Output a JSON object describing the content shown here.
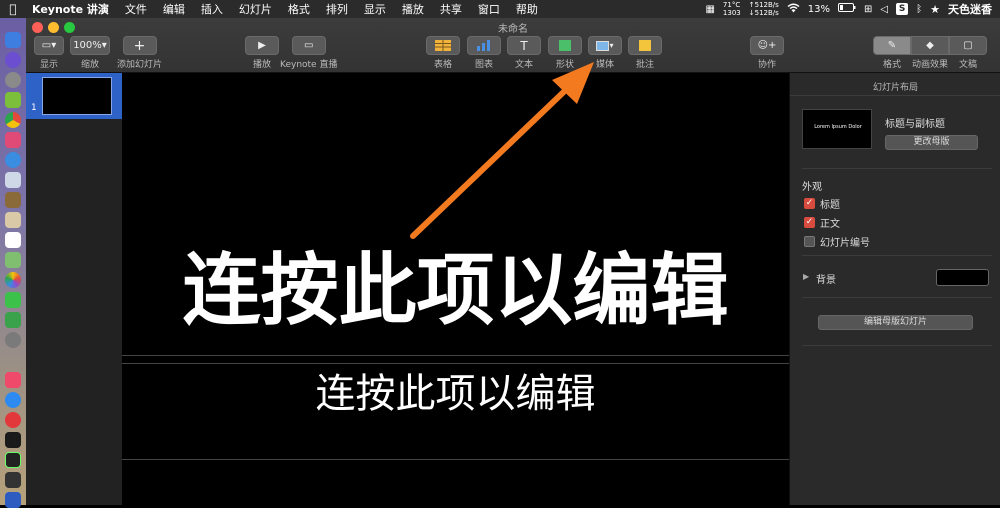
{
  "menubar": {
    "app_name": "Keynote 讲演",
    "items": [
      "文件",
      "编辑",
      "插入",
      "幻灯片",
      "格式",
      "排列",
      "显示",
      "播放",
      "共享",
      "窗口",
      "帮助"
    ],
    "status": {
      "temp": "71°C",
      "rpm": "1303",
      "net_up": "↑512B/s",
      "net_down": "↓512B/s",
      "battery": "13%",
      "user": "天色迷香"
    }
  },
  "window": {
    "title": "未命名"
  },
  "toolbar": {
    "view_label": "显示",
    "zoom_value": "100%",
    "zoom_label": "缩放",
    "add_slide_label": "添加幻灯片",
    "play_label": "播放",
    "keynote_live_label": "Keynote 直播",
    "table_label": "表格",
    "chart_label": "图表",
    "text_label": "文本",
    "shape_label": "形状",
    "media_label": "媒体",
    "comment_label": "批注",
    "collaborate_label": "协作",
    "format_label": "格式",
    "animate_label": "动画效果",
    "document_label": "文稿"
  },
  "navigator": {
    "slide_number": "1"
  },
  "slide": {
    "title": "连按此项以编辑",
    "body": "连按此项以编辑"
  },
  "inspector": {
    "header": "幻灯片布局",
    "layout_thumb_text": "Lorem Ipsum Dolor",
    "layout_name": "标题与副标题",
    "change_master_label": "更改母版",
    "appearance_label": "外观",
    "title_check_label": "标题",
    "body_check_label": "正文",
    "slide_number_check_label": "幻灯片编号",
    "background_label": "背景",
    "background_color": "#000000",
    "edit_master_label": "编辑母版幻灯片"
  },
  "colors": {
    "accent_arrow": "#f47a20",
    "selection": "#2f62c6",
    "checkbox_on": "#d84b3f"
  }
}
